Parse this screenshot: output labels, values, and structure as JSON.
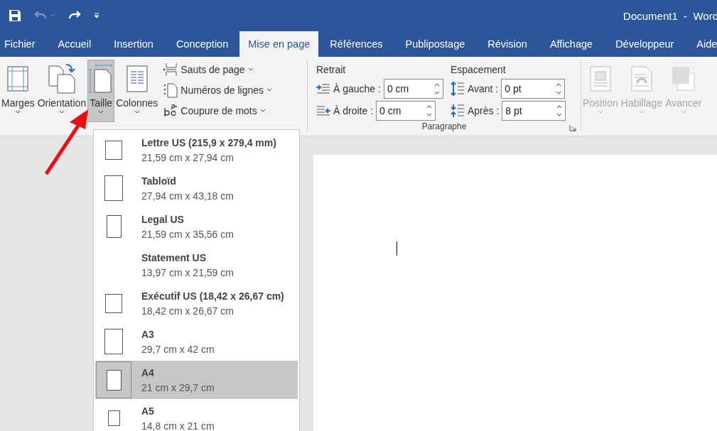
{
  "title_bar": {
    "title": "Document1  -  Word"
  },
  "tabs": [
    {
      "label": "Fichier",
      "selected": false
    },
    {
      "label": "Accueil",
      "selected": false
    },
    {
      "label": "Insertion",
      "selected": false
    },
    {
      "label": "Conception",
      "selected": false
    },
    {
      "label": "Mise en page",
      "selected": true
    },
    {
      "label": "Références",
      "selected": false
    },
    {
      "label": "Publipostage",
      "selected": false
    },
    {
      "label": "Révision",
      "selected": false
    },
    {
      "label": "Affichage",
      "selected": false
    },
    {
      "label": "Développeur",
      "selected": false
    },
    {
      "label": "Aide",
      "selected": false
    }
  ],
  "ribbon": {
    "page_setup": {
      "large_buttons": [
        {
          "label": "Marges",
          "kind": "margins",
          "selected": false
        },
        {
          "label": "Orientation",
          "kind": "orientation",
          "selected": false
        },
        {
          "label": "Taille",
          "kind": "size",
          "selected": true
        },
        {
          "label": "Colonnes",
          "kind": "columns",
          "selected": false
        }
      ],
      "small_buttons": [
        {
          "label": "Sauts de page",
          "kind": "breaks"
        },
        {
          "label": "Numéros de lignes",
          "kind": "line-numbers"
        },
        {
          "label": "Coupure de mots",
          "kind": "hyphenation"
        }
      ]
    },
    "paragraph": {
      "label": "Paragraphe",
      "indent": {
        "heading": "Retrait",
        "fields": [
          {
            "label": "À gauche :",
            "value": "0 cm",
            "kind": "indent-left"
          },
          {
            "label": "À droite :",
            "value": "0 cm",
            "kind": "indent-right"
          }
        ]
      },
      "spacing": {
        "heading": "Espacement",
        "fields": [
          {
            "label": "Avant :",
            "value": "0 pt",
            "kind": "before"
          },
          {
            "label": "Après :",
            "value": "8 pt",
            "kind": "after"
          }
        ]
      }
    },
    "arrange": {
      "buttons": [
        {
          "label": "Position",
          "kind": "position",
          "disabled": true
        },
        {
          "label": "Habillage",
          "kind": "wrap",
          "disabled": true
        },
        {
          "label": "Avancer",
          "kind": "forward",
          "disabled": true
        }
      ]
    }
  },
  "size_menu": {
    "items": [
      {
        "name": "Lettre US (215,9 x 279,4 mm)",
        "dimensions": "21,59 cm x 27,94 cm",
        "kind": "small",
        "selected": false
      },
      {
        "name": "Tabloïd",
        "dimensions": "27,94 cm x 43,18 cm",
        "kind": "tall",
        "selected": false
      },
      {
        "name": "Legal US",
        "dimensions": "21,59 cm x 35,56 cm",
        "kind": "narrow",
        "selected": false
      },
      {
        "name": "Statement US",
        "dimensions": "13,97 cm x 21,59 cm",
        "kind": "none",
        "selected": false
      },
      {
        "name": "Exécutif US (18,42 x 26,67 cm)",
        "dimensions": "18,42 cm x 26,67 cm",
        "kind": "small",
        "selected": false
      },
      {
        "name": "A3",
        "dimensions": "29,7 cm x 42 cm",
        "kind": "tall",
        "selected": false
      },
      {
        "name": "A4",
        "dimensions": "21 cm x 29,7 cm",
        "kind": "medium",
        "selected": true
      },
      {
        "name": "A5",
        "dimensions": "14,8 cm x 21 cm",
        "kind": "tiny",
        "selected": false
      }
    ]
  }
}
